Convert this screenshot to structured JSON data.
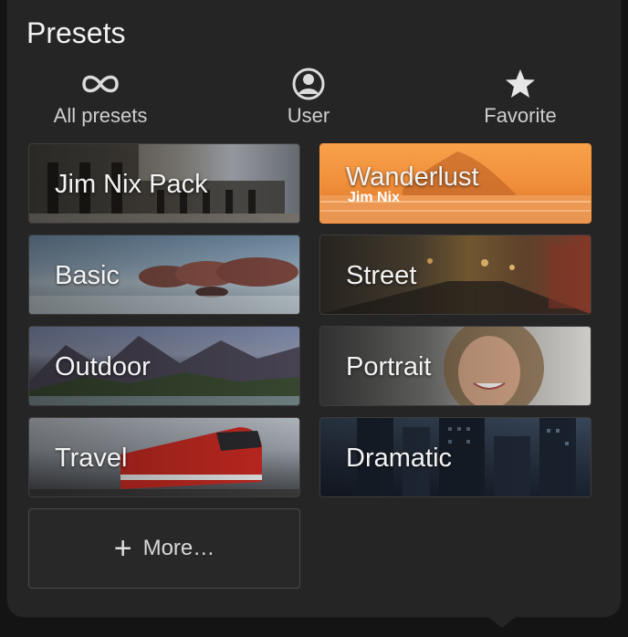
{
  "panel": {
    "title": "Presets"
  },
  "filters": [
    {
      "label": "All presets",
      "icon": "infinity-icon"
    },
    {
      "label": "User",
      "icon": "user-icon"
    },
    {
      "label": "Favorite",
      "icon": "star-icon"
    }
  ],
  "presets": [
    {
      "label": "Jim Nix Pack",
      "subtitle": ""
    },
    {
      "label": "Wanderlust",
      "subtitle": "Jim Nix",
      "selected": true
    },
    {
      "label": "Basic",
      "subtitle": ""
    },
    {
      "label": "Street",
      "subtitle": ""
    },
    {
      "label": "Outdoor",
      "subtitle": ""
    },
    {
      "label": "Portrait",
      "subtitle": ""
    },
    {
      "label": "Travel",
      "subtitle": ""
    },
    {
      "label": "Dramatic",
      "subtitle": ""
    }
  ],
  "more": {
    "label": "More…",
    "icon": "plus-icon"
  },
  "colors": {
    "accent": "#f7953a",
    "panel_bg": "#252525",
    "text": "#f2f2f2"
  }
}
